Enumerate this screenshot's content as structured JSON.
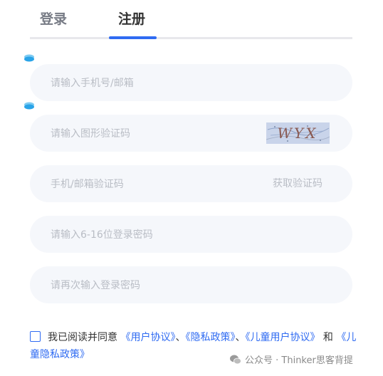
{
  "tabs": {
    "login": "登录",
    "register": "注册"
  },
  "form": {
    "account_placeholder": "请输入手机号/邮箱",
    "captcha_placeholder": "请输入图形验证码",
    "captcha_text": "WYX",
    "sms_placeholder": "手机/邮箱验证码",
    "get_code_label": "获取验证码",
    "password_placeholder": "请输入6-16位登录密码",
    "confirm_placeholder": "请再次输入登录密码"
  },
  "agreement": {
    "prefix": "我已阅读并同意",
    "user_agreement": "《用户协议》",
    "sep1": "、",
    "privacy_policy": "《隐私政策》",
    "sep2": "、",
    "children_agreement": "《儿童用户协议》",
    "conj": "和",
    "children_privacy": "《儿童隐私政策》"
  },
  "watermark": {
    "text": "公众号 · Thinker思客背提"
  },
  "colors": {
    "accent": "#2f6bf2",
    "field_bg": "#f5f7fb",
    "placeholder": "#b9bdc5"
  },
  "icons": {
    "marker": "fill-marker-icon",
    "wechat": "wechat-icon"
  }
}
